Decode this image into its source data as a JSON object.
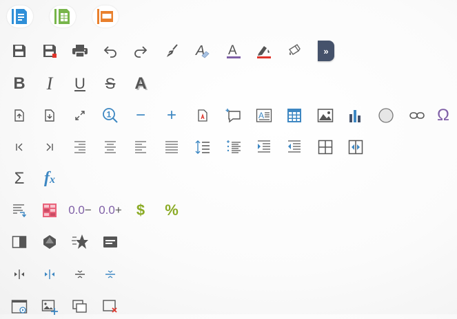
{
  "colors": {
    "icon_gray": "#555555",
    "accent_blue": "#3d87c2",
    "writer_blue": "#2f8fd8",
    "calc_green": "#78b54b",
    "impress_orange": "#e9802d",
    "purple": "#7f5fa6",
    "red": "#e0352b",
    "dollar_green": "#8bab26",
    "more_button_bg": "#45526b"
  },
  "app_switcher": {
    "writer_icon": "document-icon",
    "calc_icon": "spreadsheet-icon",
    "impress_icon": "presentation-icon"
  },
  "toolbar_row_1": {
    "icons": [
      "save-icon",
      "save-as-icon",
      "print-icon",
      "undo-icon",
      "redo-icon",
      "clear-formatting-icon",
      "font-style-icon",
      "font-color-icon",
      "highlight-color-icon",
      "paint-format-icon"
    ],
    "more_label": "»"
  },
  "toolbar_row_2": {
    "bold_label": "B",
    "italic_label": "I",
    "underline_label": "U",
    "strikethrough_label": "S",
    "shadow_label": "A"
  },
  "toolbar_row_3": {
    "zoom_label": "1",
    "zoom_out_label": "−",
    "zoom_in_label": "+",
    "omega_label": "Ω",
    "icons": [
      "page-prev-icon",
      "page-next-icon",
      "fullscreen-icon",
      "zoom-icon",
      "zoom-out-icon",
      "zoom-in-icon",
      "export-pdf-icon",
      "comment-icon",
      "text-box-icon",
      "table-icon",
      "image-icon",
      "chart-icon",
      "shape-icon",
      "link-icon",
      "special-character-icon"
    ]
  },
  "toolbar_row_4": {
    "icons": [
      "first-page-icon",
      "next-icon",
      "align-right-icon",
      "align-center-icon",
      "align-left-icon",
      "justify-icon",
      "line-spacing-icon",
      "bullet-list-icon",
      "increase-indent-icon",
      "decrease-indent-icon",
      "insert-row-icon",
      "insert-column-icon"
    ]
  },
  "toolbar_row_5": {
    "sum_label": "Σ",
    "function_label": "f",
    "function_sub_label": "x"
  },
  "toolbar_row_6": {
    "decimal_remove_label": "0.0",
    "decimal_remove_sign": "−",
    "decimal_add_label": "0.0",
    "decimal_add_sign": "+",
    "currency_label": "$",
    "percent_label": "%"
  },
  "toolbar_row_7": {
    "icons": [
      "sidebar-icon",
      "shapes-icon",
      "star-icon",
      "form-icon"
    ]
  },
  "toolbar_row_8": {
    "icons": [
      "split-horizontal-icon",
      "split-horizontal-blue-icon",
      "divide-icon",
      "divide-blue-icon"
    ]
  },
  "toolbar_row_9": {
    "icons": [
      "slide-show-icon",
      "insert-image-icon",
      "duplicate-slide-icon",
      "delete-slide-icon"
    ]
  }
}
